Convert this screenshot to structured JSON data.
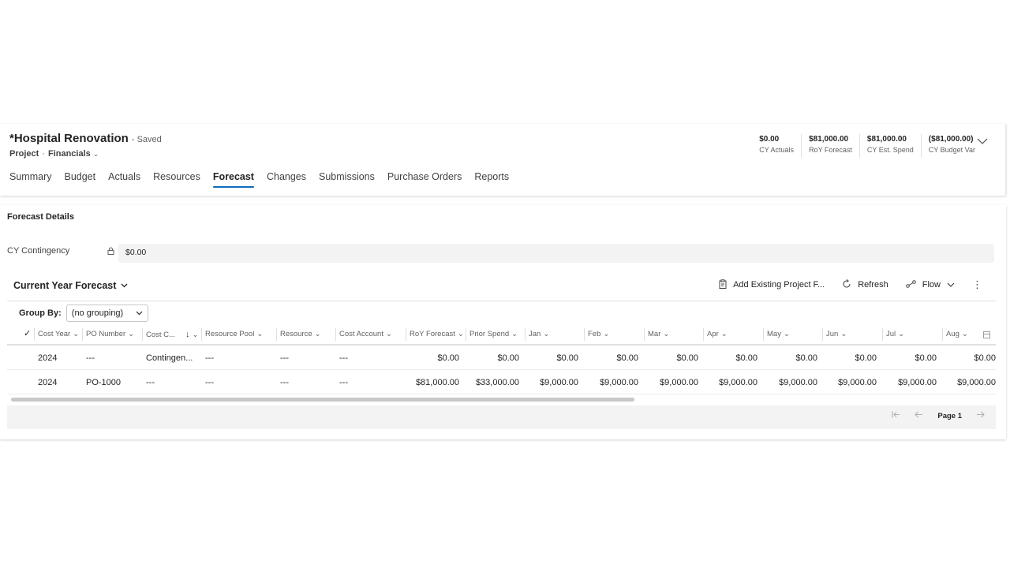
{
  "header": {
    "title": "*Hospital Renovation",
    "save_state": "- Saved",
    "entity": "Project",
    "separator": "·",
    "form": "Financials",
    "kpis": [
      {
        "value": "$0.00",
        "label": "CY Actuals"
      },
      {
        "value": "$81,000.00",
        "label": "RoY Forecast"
      },
      {
        "value": "$81,000.00",
        "label": "CY Est. Spend"
      },
      {
        "value": "($81,000.00)",
        "label": "CY Budget Var"
      }
    ],
    "tabs": [
      "Summary",
      "Budget",
      "Actuals",
      "Resources",
      "Forecast",
      "Changes",
      "Submissions",
      "Purchase Orders",
      "Reports"
    ],
    "active_tab": "Forecast"
  },
  "details": {
    "section_title": "Forecast Details",
    "contingency_label": "CY Contingency",
    "contingency_value": "$0.00",
    "grid_title": "Current Year Forecast",
    "commands": {
      "add_existing": "Add Existing Project F...",
      "refresh": "Refresh",
      "flow": "Flow"
    },
    "group_by_label": "Group By:",
    "group_by_value": "(no grouping)",
    "columns": [
      "Cost Year",
      "PO Number",
      "Cost C...",
      "Resource Pool",
      "Resource",
      "Cost Account",
      "RoY Forecast",
      "Prior Spend",
      "Jan",
      "Feb",
      "Mar",
      "Apr",
      "May",
      "Jun",
      "Jul",
      "Aug"
    ],
    "rows": [
      [
        "2024",
        "---",
        "Contingen...",
        "---",
        "---",
        "---",
        "$0.00",
        "$0.00",
        "$0.00",
        "$0.00",
        "$0.00",
        "$0.00",
        "$0.00",
        "$0.00",
        "$0.00",
        "$0.00"
      ],
      [
        "2024",
        "PO-1000",
        "---",
        "---",
        "---",
        "---",
        "$81,000.00",
        "$33,000.00",
        "$9,000.00",
        "$9,000.00",
        "$9,000.00",
        "$9,000.00",
        "$9,000.00",
        "$9,000.00",
        "$9,000.00",
        "$9,000.00"
      ]
    ],
    "page_label": "Page 1"
  },
  "colors": {
    "accent": "#0f6cbd",
    "panel_bg": "#f3f3f3"
  }
}
